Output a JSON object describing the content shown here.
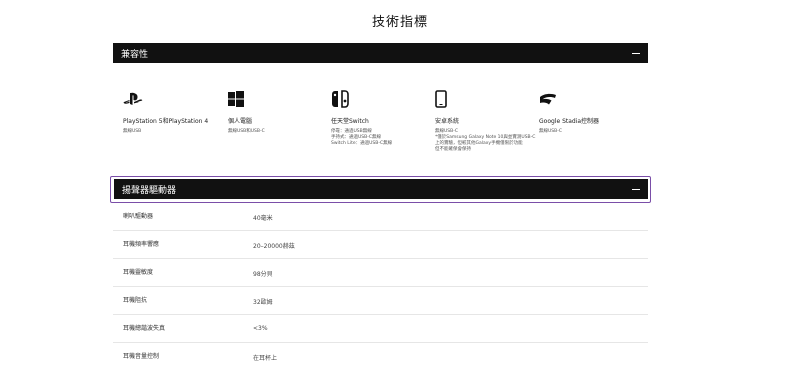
{
  "page": {
    "title": "技術指標"
  },
  "compat": {
    "header": "兼容性",
    "items": [
      {
        "icon": "playstation-icon",
        "name": "PlayStation 5和PlayStation 4",
        "detail": "無線USB"
      },
      {
        "icon": "windows-icon",
        "name": "個人電腦",
        "detail": "無線USB和USB-C"
      },
      {
        "icon": "nintendo-switch-icon",
        "name": "任天堂Switch",
        "detail": "停靠：通過USB無線\n手持式：通過USB-C無線\nSwitch Lite：通過USB-C無線"
      },
      {
        "icon": "smartphone-icon",
        "name": "安卓系統",
        "detail": "無線USB-C\n*僅於Samsung Galaxy Note 10與並實測USB-C\n上的實驗，但較其他Galaxy手機僅限於功能\n但不能確保會保持"
      },
      {
        "icon": "stadia-icon",
        "name": "Google Stadia控制器",
        "detail": "無線USB-C"
      }
    ]
  },
  "driver": {
    "header": "揚聲器驅動器",
    "rows": [
      {
        "label": "喇叭驅動器",
        "value": "40毫米"
      },
      {
        "label": "耳機頻率響應",
        "value": "20–20000赫茲"
      },
      {
        "label": "耳機靈敏度",
        "value": "98分貝"
      },
      {
        "label": "耳機阻抗",
        "value": "32歐姆"
      },
      {
        "label": "耳機總諧波失真",
        "value": "<3%"
      },
      {
        "label": "耳機音量控制",
        "value": "在耳杯上"
      }
    ]
  }
}
